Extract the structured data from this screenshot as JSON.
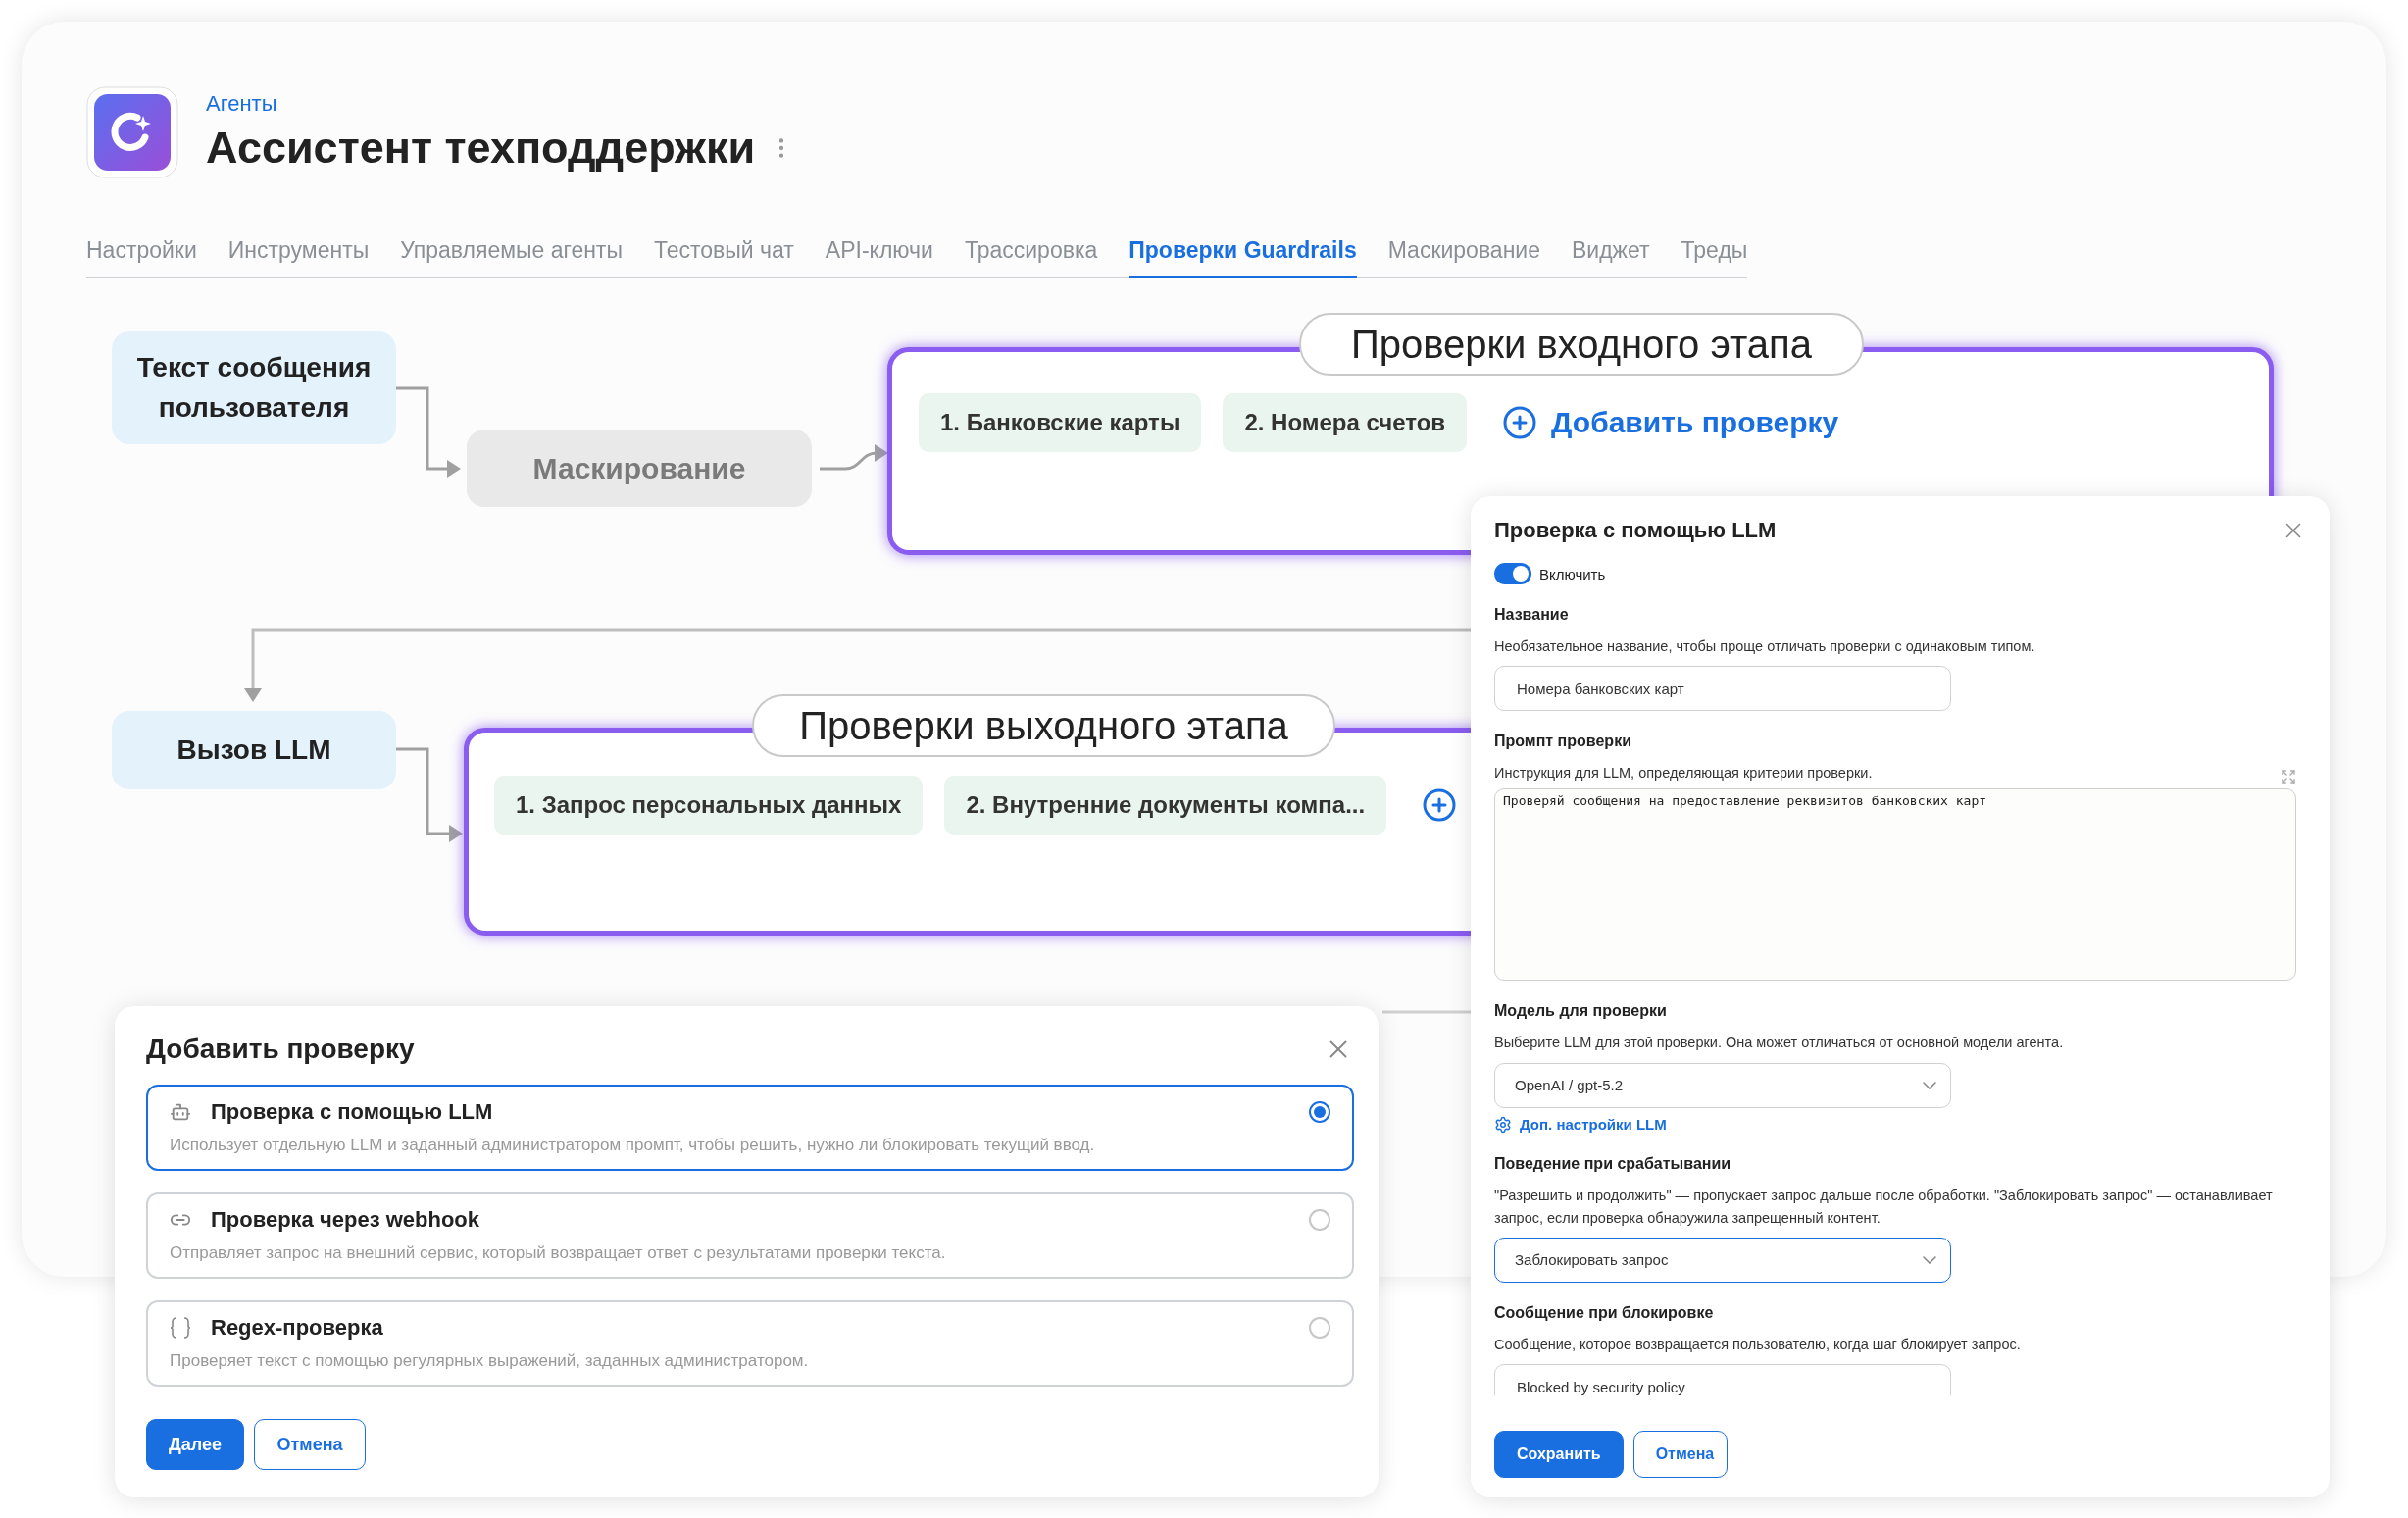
{
  "header": {
    "breadcrumb": "Агенты",
    "title": "Ассистент техподдержки"
  },
  "tabs": [
    {
      "label": "Настройки",
      "selected": false
    },
    {
      "label": "Инструменты",
      "selected": false
    },
    {
      "label": "Управляемые агенты",
      "selected": false
    },
    {
      "label": "Тестовый чат",
      "selected": false
    },
    {
      "label": "API-ключи",
      "selected": false
    },
    {
      "label": "Трассировка",
      "selected": false
    },
    {
      "label": "Проверки Guardrails",
      "selected": true
    },
    {
      "label": "Маскирование",
      "selected": false
    },
    {
      "label": "Виджет",
      "selected": false
    },
    {
      "label": "Треды",
      "selected": false
    }
  ],
  "flow": {
    "user_message": "Текст сообщения пользователя",
    "masking": "Маскирование",
    "llm_call": "Вызов LLM",
    "input_stage": {
      "title": "Проверки входного этапа",
      "checks": [
        "1. Банковские карты",
        "2. Номера счетов"
      ],
      "add_label": "Добавить проверку"
    },
    "output_stage": {
      "title": "Проверки выходного этапа",
      "checks": [
        "1. Запрос персональных данных",
        "2. Внутренние документы компа..."
      ]
    }
  },
  "add_check_dialog": {
    "title": "Добавить проверку",
    "options": [
      {
        "kind": "llm",
        "title": "Проверка с помощью LLM",
        "description": "Использует отдельную LLM и заданный администратором промпт, чтобы решить, нужно ли блокировать текущий ввод.",
        "selected": true
      },
      {
        "kind": "webhook",
        "title": "Проверка через webhook",
        "description": "Отправляет запрос на внешний сервис, который возвращает ответ с результатами проверки текста.",
        "selected": false
      },
      {
        "kind": "regex",
        "title": "Regex-проверка",
        "description": "Проверяет текст с помощью регулярных выражений, заданных администратором.",
        "selected": false
      }
    ],
    "primary_button": "Далее",
    "secondary_button": "Отмена"
  },
  "llm_check_panel": {
    "title": "Проверка с помощью LLM",
    "enable": {
      "label": "Включить",
      "on": true
    },
    "name": {
      "label": "Название",
      "hint": "Необязательное название, чтобы проще отличать проверки с одинаковым типом.",
      "value": "Номера банковских карт"
    },
    "prompt": {
      "label": "Промпт проверки",
      "hint": "Инструкция для LLM, определяющая критерии проверки.",
      "value": "Проверяй сообщения на предоставление реквизитов банковских карт"
    },
    "model": {
      "label": "Модель для проверки",
      "hint": "Выберите LLM для этой проверки. Она может отличаться от основной модели агента.",
      "value": "OpenAI / gpt-5.2",
      "focused": false
    },
    "advanced_link": "Доп. настройки LLM",
    "behavior": {
      "label": "Поведение при срабатывании",
      "hint": "\"Разрешить и продолжить\" — пропускает запрос дальше после обработки. \"Заблокировать запрос\" — останавливает запрос, если проверка обнаружила запрещенный контент.",
      "value": "Заблокировать запрос",
      "focused": true
    },
    "block_message": {
      "label": "Сообщение при блокировке",
      "hint": "Сообщение, которое возвращается пользователю, когда шаг блокирует запрос.",
      "value": "Blocked by security policy"
    },
    "primary_button": "Сохранить",
    "secondary_button": "Отмена"
  }
}
